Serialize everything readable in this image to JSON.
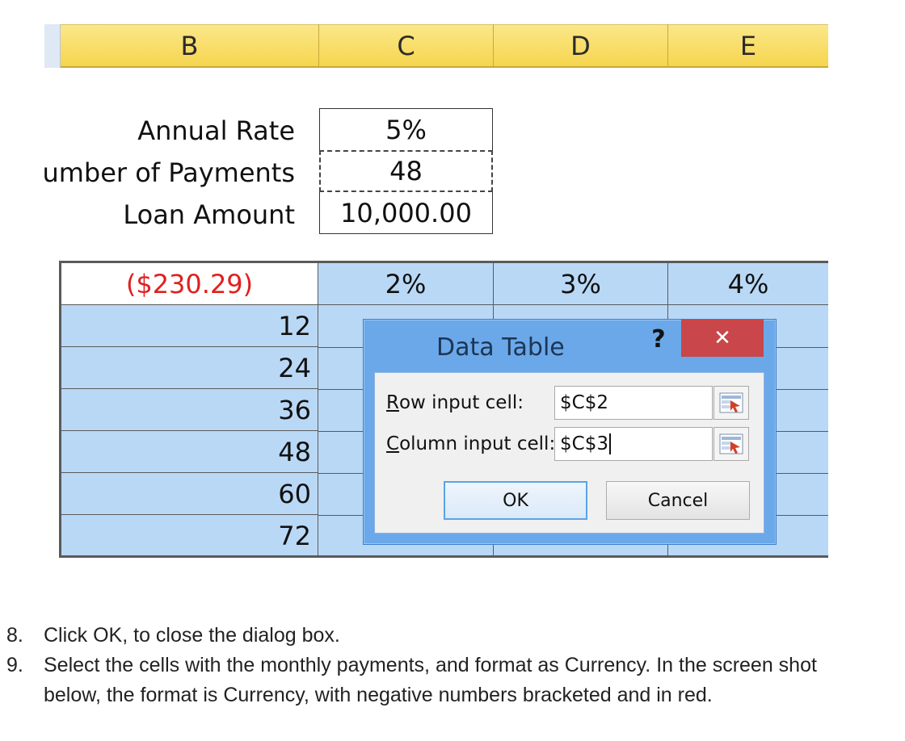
{
  "columns": [
    "B",
    "C",
    "D",
    "E"
  ],
  "inputs": [
    {
      "label": "umber of Payments",
      "full_label": "Annual Rate",
      "value": "5%"
    }
  ],
  "input_rows": {
    "annual_rate_label": "Annual Rate",
    "annual_rate_value": "5%",
    "num_payments_label": "umber of Payments",
    "num_payments_value": "48",
    "loan_amount_label": "Loan Amount",
    "loan_amount_value": "10,000.00"
  },
  "data_table": {
    "formula_result": "($230.29)",
    "rate_headers": [
      "2%",
      "3%",
      "4%"
    ],
    "payment_rows": [
      "12",
      "24",
      "36",
      "48",
      "60",
      "72"
    ],
    "result_color": "#e02020",
    "fill_color": "#b9d8f6"
  },
  "dialog": {
    "title": "Data Table",
    "help_label": "?",
    "close_label": "✕",
    "row_input_label_accel": "R",
    "row_input_label_rest": "ow input cell:",
    "row_input_value": "$C$2",
    "col_input_label_accel": "C",
    "col_input_label_rest": "olumn input cell:",
    "col_input_value": "$C$3",
    "ok_label": "OK",
    "cancel_label": "Cancel",
    "close_color": "#c9464a",
    "frame_color": "#6aa8ea"
  },
  "instructions": [
    {
      "num": "8.",
      "text": "Click OK, to close the dialog box."
    },
    {
      "num": "9.",
      "text": "Select the cells with the monthly payments, and format as Currency. In the screen shot below, the format is Currency, with negative numbers bracketed and in red."
    }
  ]
}
